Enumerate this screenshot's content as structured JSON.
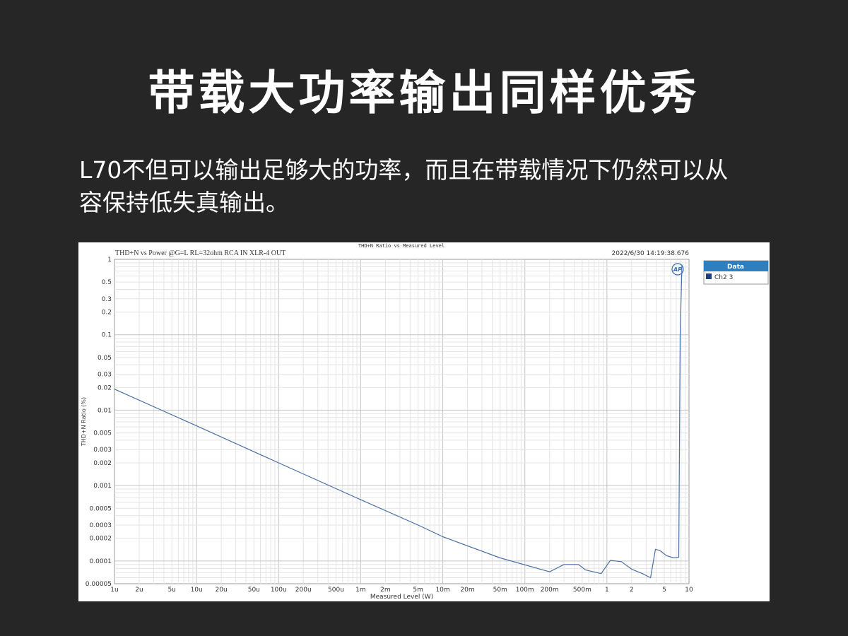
{
  "header": {
    "title": "带载大功率输出同样优秀"
  },
  "description": {
    "line1": "L70不但可以输出足够大的功率，而且在带载情况下仍然可以从",
    "line2": "容保持低失真输出。"
  },
  "chart_data": {
    "type": "line",
    "window_title": "THD+N Ratio vs Measured Level",
    "title": "THD+N vs Power @G=L RL=32ohm RCA IN XLR-4 OUT",
    "timestamp": "2022/6/30 14:19:38.676",
    "xlabel": "Measured Level (W)",
    "ylabel": "THD+N Ratio (%)",
    "x_scale": "log",
    "y_scale": "log",
    "xlim": [
      1e-06,
      10
    ],
    "ylim": [
      5e-05,
      1
    ],
    "grid": true,
    "legend_position": "right",
    "legend_header": "Data",
    "logo_text": "AP",
    "x_ticks": [
      {
        "v": 1e-06,
        "label": "1u"
      },
      {
        "v": 2e-06,
        "label": "2u"
      },
      {
        "v": 5e-06,
        "label": "5u"
      },
      {
        "v": 1e-05,
        "label": "10u"
      },
      {
        "v": 2e-05,
        "label": "20u"
      },
      {
        "v": 5e-05,
        "label": "50u"
      },
      {
        "v": 0.0001,
        "label": "100u"
      },
      {
        "v": 0.0002,
        "label": "200u"
      },
      {
        "v": 0.0005,
        "label": "500u"
      },
      {
        "v": 0.001,
        "label": "1m"
      },
      {
        "v": 0.002,
        "label": "2m"
      },
      {
        "v": 0.005,
        "label": "5m"
      },
      {
        "v": 0.01,
        "label": "10m"
      },
      {
        "v": 0.02,
        "label": "20m"
      },
      {
        "v": 0.05,
        "label": "50m"
      },
      {
        "v": 0.1,
        "label": "100m"
      },
      {
        "v": 0.2,
        "label": "200m"
      },
      {
        "v": 0.5,
        "label": "500m"
      },
      {
        "v": 1,
        "label": "1"
      },
      {
        "v": 2,
        "label": "2"
      },
      {
        "v": 5,
        "label": "5"
      },
      {
        "v": 10,
        "label": "10"
      }
    ],
    "y_ticks": [
      {
        "v": 1,
        "label": "1"
      },
      {
        "v": 0.5,
        "label": "0.5"
      },
      {
        "v": 0.3,
        "label": "0.3"
      },
      {
        "v": 0.2,
        "label": "0.2"
      },
      {
        "v": 0.1,
        "label": "0.1"
      },
      {
        "v": 0.05,
        "label": "0.05"
      },
      {
        "v": 0.03,
        "label": "0.03"
      },
      {
        "v": 0.02,
        "label": "0.02"
      },
      {
        "v": 0.01,
        "label": "0.01"
      },
      {
        "v": 0.005,
        "label": "0.005"
      },
      {
        "v": 0.003,
        "label": "0.003"
      },
      {
        "v": 0.002,
        "label": "0.002"
      },
      {
        "v": 0.001,
        "label": "0.001"
      },
      {
        "v": 0.0005,
        "label": "0.0005"
      },
      {
        "v": 0.0003,
        "label": "0.0003"
      },
      {
        "v": 0.0002,
        "label": "0.0002"
      },
      {
        "v": 0.0001,
        "label": "0.0001"
      },
      {
        "v": 5e-05,
        "label": "0.00005"
      }
    ],
    "series": [
      {
        "name": "Ch2 3",
        "color": "#4a6fa5",
        "x": [
          1e-06,
          1e-05,
          0.0001,
          0.001,
          0.005,
          0.01,
          0.05,
          0.2,
          0.3,
          0.45,
          0.55,
          0.85,
          1.1,
          1.5,
          2.0,
          2.7,
          3.4,
          3.9,
          4.4,
          5.3,
          6.5,
          7.5,
          7.8,
          8.2
        ],
        "y": [
          0.019,
          0.0062,
          0.002,
          0.00065,
          0.0003,
          0.00021,
          0.00011,
          7.2e-05,
          9e-05,
          9e-05,
          7.6e-05,
          6.8e-05,
          0.000102,
          9.8e-05,
          7.8e-05,
          6.8e-05,
          6e-05,
          0.000143,
          0.000138,
          0.000118,
          0.00011,
          0.000112,
          0.1,
          0.85
        ]
      }
    ]
  }
}
